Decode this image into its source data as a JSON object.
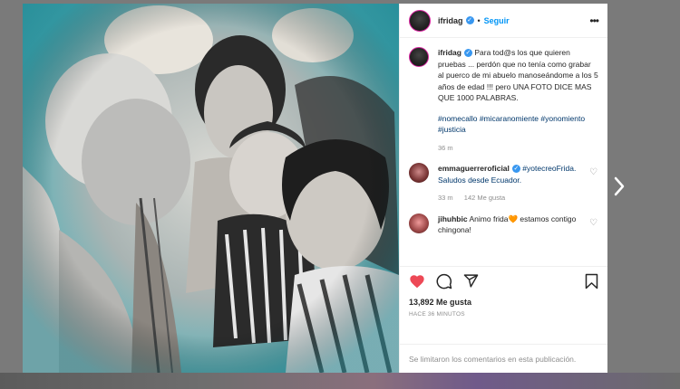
{
  "post": {
    "author": "ifridag",
    "follow_label": "Seguir",
    "dot": "•"
  },
  "caption": {
    "author": "ifridag",
    "text": "Para tod@s los que quieren pruebas ... perdón que no tenía como grabar al puerco de mi abuelo manoseándome a los 5 años de edad !!! pero UNA FOTO DICE MAS QUE 1000 PALABRAS.",
    "hashtags": "#nomecallo #micaranomiente #yonomiento #justicia",
    "time": "36 m"
  },
  "comments": [
    {
      "author": "emmaguerreroficial",
      "text": "#yotecreoFrida. Saludos desde Ecuador.",
      "time": "33 m",
      "likes": "142 Me gusta"
    },
    {
      "author": "jihuhbic",
      "text": "Animo frida🧡 estamos contigo chingona!"
    }
  ],
  "stats": {
    "likes": "13,892 Me gusta",
    "posted": "HACE 36 MINUTOS"
  },
  "comments_disabled": "Se limitaron los comentarios en esta publicación.",
  "icons": {
    "like": "heart-icon",
    "comment": "comment-icon",
    "share": "share-icon",
    "save": "bookmark-icon",
    "next": "chevron-right-icon"
  },
  "colors": {
    "accent": "#0095f6",
    "liked": "#ed4956",
    "verified": "#3897f0"
  }
}
